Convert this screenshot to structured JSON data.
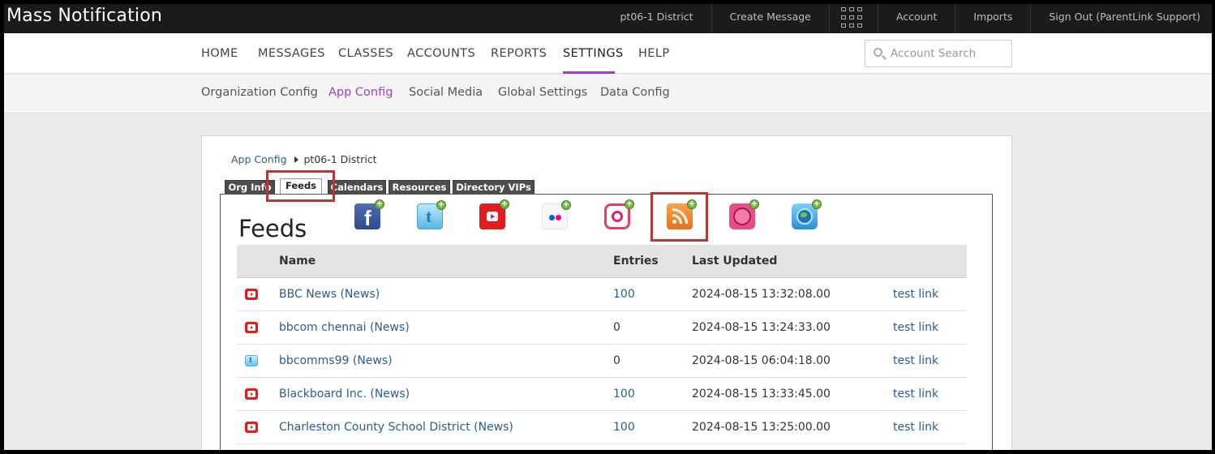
{
  "app": {
    "title": "Mass Notification"
  },
  "topnav": {
    "district": "pt06-1 District",
    "create_message": "Create Message",
    "account": "Account",
    "imports": "Imports",
    "sign_out": "Sign Out (ParentLink Support)"
  },
  "mainnav": {
    "items": [
      "HOME",
      "MESSAGES",
      "CLASSES",
      "ACCOUNTS",
      "REPORTS",
      "SETTINGS",
      "HELP"
    ],
    "active": "SETTINGS",
    "search_placeholder": "Account Search"
  },
  "subnav": {
    "items": [
      "Organization Config",
      "App Config",
      "Social Media",
      "Global Settings",
      "Data Config"
    ],
    "active": "App Config"
  },
  "breadcrumb": {
    "parent": "App Config",
    "current": "pt06-1 District"
  },
  "tabs": {
    "items": [
      "Org Info",
      "Feeds",
      "Calendars",
      "Resources",
      "Directory VIPs"
    ],
    "active": "Feeds"
  },
  "feeds": {
    "title": "Feeds",
    "add_icons": [
      "facebook-add-icon",
      "twitter-add-icon",
      "youtube-add-icon",
      "flickr-add-icon",
      "instagram-add-icon",
      "rss-add-icon",
      "dribbble-add-icon",
      "globe-add-icon"
    ],
    "highlighted_icon": "rss-add-icon",
    "highlight_color": "#b33a3a",
    "columns": [
      "",
      "Name",
      "Entries",
      "Last Updated",
      ""
    ],
    "rows": [
      {
        "icon": "youtube-icon",
        "name": "BBC News (News)",
        "entries": "100",
        "updated": "2024-08-15 13:32:08.00",
        "link": "test link"
      },
      {
        "icon": "youtube-icon",
        "name": "bbcom chennai (News)",
        "entries": "0",
        "updated": "2024-08-15 13:24:33.00",
        "link": "test link"
      },
      {
        "icon": "twitter-icon",
        "name": "bbcomms99 (News)",
        "entries": "0",
        "updated": "2024-08-15 06:04:18.00",
        "link": "test link"
      },
      {
        "icon": "youtube-icon",
        "name": "Blackboard Inc. (News)",
        "entries": "100",
        "updated": "2024-08-15 13:33:45.00",
        "link": "test link"
      },
      {
        "icon": "youtube-icon",
        "name": "Charleston County School District (News)",
        "entries": "100",
        "updated": "2024-08-15 13:25:00.00",
        "link": "test link"
      }
    ]
  },
  "colors": {
    "accent": "#a43fbf",
    "link": "#2d5d8f",
    "topbar": "#1b1b1b"
  }
}
